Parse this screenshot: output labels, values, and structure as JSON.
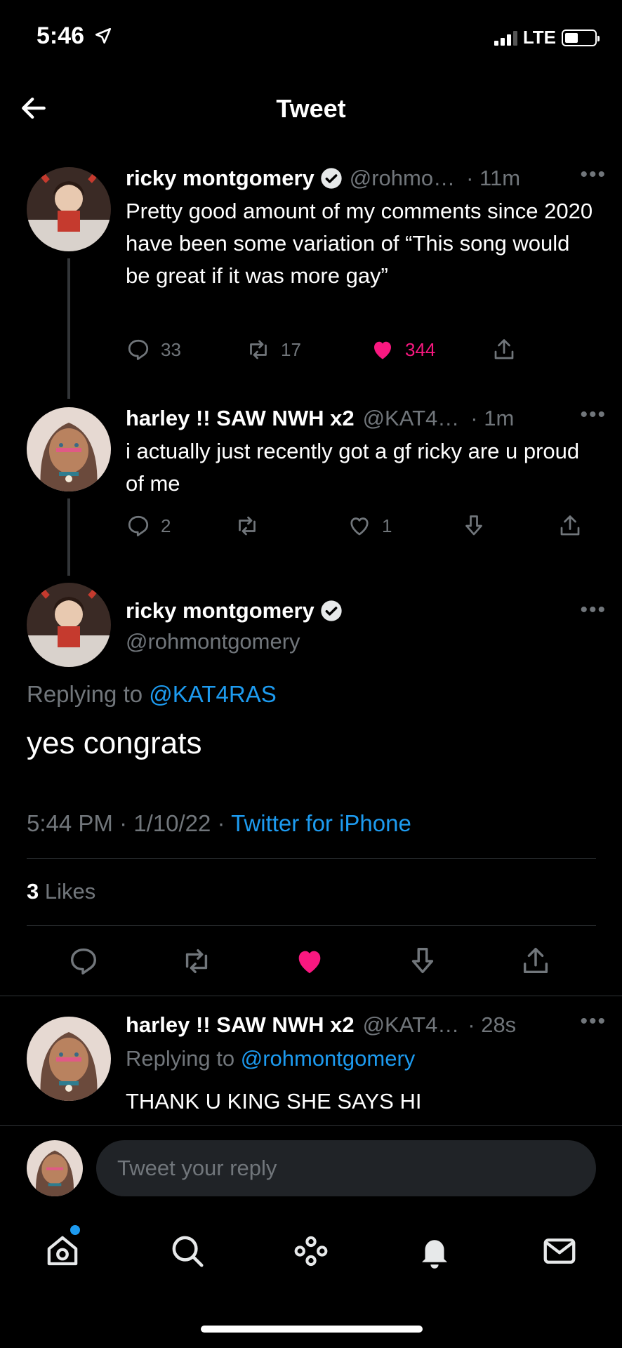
{
  "status_bar": {
    "time": "5:46",
    "network": "LTE"
  },
  "header": {
    "title": "Tweet"
  },
  "thread": [
    {
      "name": "ricky montgomery",
      "handle": "@rohmo…",
      "time": "· 11m",
      "text": "Pretty good amount of my comments since 2020 have been some variation of “This song would be great if it was more gay”",
      "replies": "33",
      "retweets": "17",
      "likes": "344"
    },
    {
      "name": "harley !! SAW NWH x2",
      "handle": "@KAT4…",
      "time": "· 1m",
      "text": "i actually just recently got a gf ricky are u proud of me",
      "replies": "2",
      "likes": "1"
    }
  ],
  "main_tweet": {
    "name": "ricky montgomery",
    "handle": "@rohmontgomery",
    "replying_prefix": "Replying to",
    "replying_to": "@KAT4RAS",
    "text": "yes congrats",
    "timestamp": "5:44 PM · 1/10/22 ·",
    "source": "Twitter for iPhone",
    "likes_count": "3",
    "likes_label": "Likes"
  },
  "reply": {
    "name": "harley !! SAW NWH x2",
    "handle": "@KAT4…",
    "time": "· 28s",
    "replying_prefix": "Replying to",
    "replying_to": "@rohmontgomery",
    "text": "THANK U KING SHE SAYS HI"
  },
  "composer": {
    "placeholder": "Tweet your reply"
  },
  "colors": {
    "accent": "#1d9bf0",
    "like": "#f91880",
    "background": "#000000"
  },
  "tab_bar": [
    "home-icon",
    "search-icon",
    "spaces-icon",
    "notifications-icon",
    "messages-icon"
  ]
}
